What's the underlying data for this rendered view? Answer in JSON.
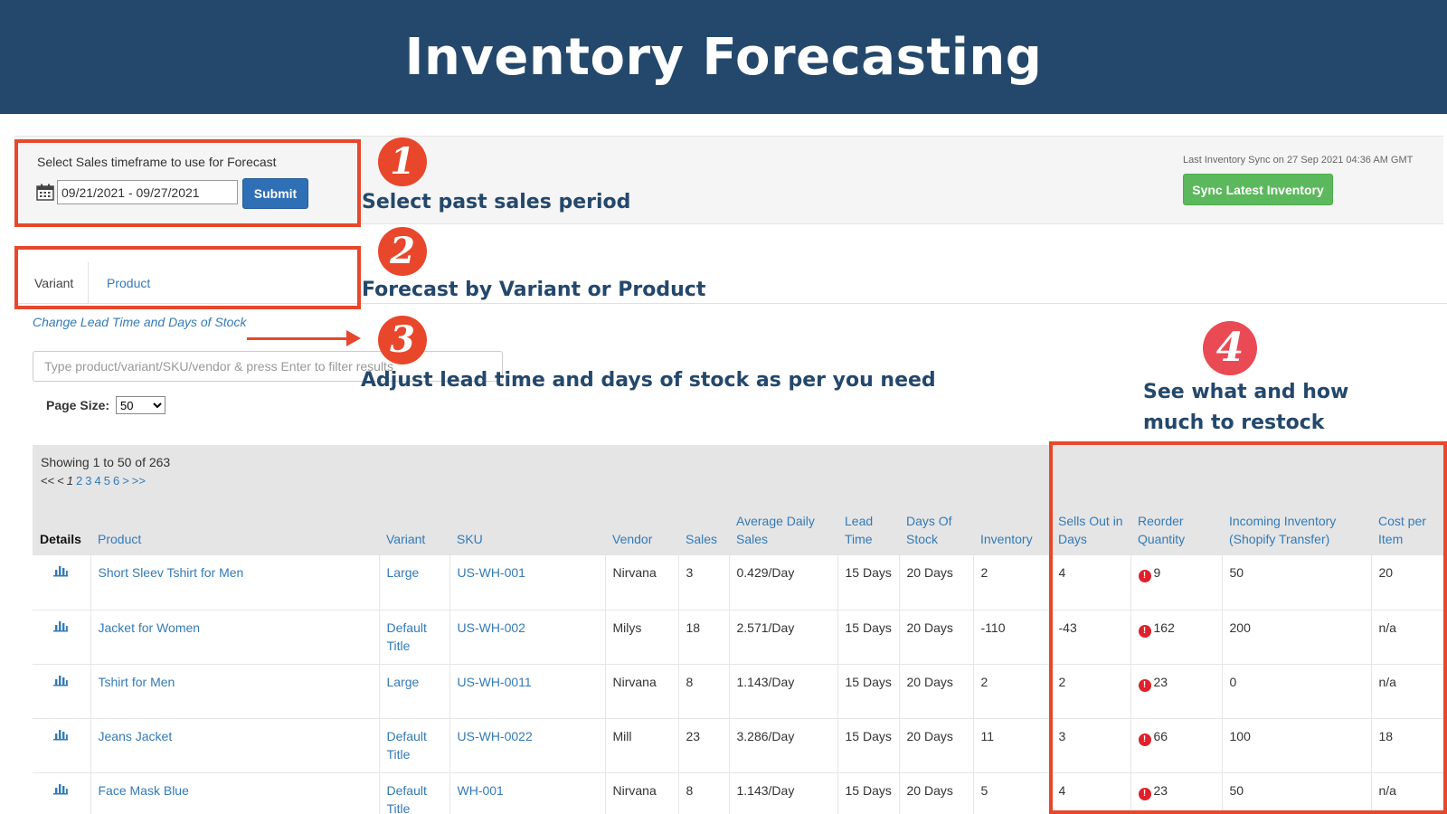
{
  "banner": {
    "title": "Inventory Forecasting"
  },
  "annotations": [
    {
      "number": "1",
      "text": "Select past sales period"
    },
    {
      "number": "2",
      "text": "Forecast  by Variant or Product"
    },
    {
      "number": "3",
      "text": "Adjust lead time and days of stock as per you need"
    },
    {
      "number": "4",
      "text": "See what and how much to restock"
    }
  ],
  "timeframe": {
    "label": "Select Sales timeframe to use for Forecast",
    "date_range": "09/21/2021 - 09/27/2021",
    "submit_label": "Submit"
  },
  "sync": {
    "last_sync_text": "Last Inventory Sync on 27 Sep 2021 04:36 AM GMT",
    "button_label": "Sync Latest Inventory"
  },
  "tabs": [
    {
      "label": "Variant",
      "active": true
    },
    {
      "label": "Product",
      "active": false
    }
  ],
  "lead_time_link": "Change Lead Time and Days of Stock",
  "filter": {
    "placeholder": "Type product/variant/SKU/vendor & press Enter to filter results"
  },
  "page_size": {
    "label": "Page Size:",
    "selected": "50"
  },
  "grid": {
    "showing": "Showing 1 to 50 of 263",
    "pager": {
      "first": "<<",
      "prev": "<",
      "current": "1",
      "pages": [
        "2",
        "3",
        "4",
        "5",
        "6"
      ],
      "next": ">",
      "last": ">>"
    },
    "columns": [
      "Details",
      "Product",
      "Variant",
      "SKU",
      "Vendor",
      "Sales",
      "Average Daily Sales",
      "Lead Time",
      "Days Of Stock",
      "Inventory",
      "Sells Out in Days",
      "Reorder Quantity",
      "Incoming Inventory (Shopify Transfer)",
      "Cost per Item"
    ],
    "rows": [
      {
        "product": "Short Sleev Tshirt for Men",
        "variant": "Large",
        "sku": "US-WH-001",
        "vendor": "Nirvana",
        "sales": "3",
        "avg_daily": "0.429/Day",
        "lead_time": "15 Days",
        "days_stock": "20 Days",
        "inventory": "2",
        "sells_out": "4",
        "reorder": "9",
        "incoming": "50",
        "cost": "20"
      },
      {
        "product": "Jacket for Women",
        "variant": "Default Title",
        "sku": "US-WH-002",
        "vendor": "Milys",
        "sales": "18",
        "avg_daily": "2.571/Day",
        "lead_time": "15 Days",
        "days_stock": "20 Days",
        "inventory": "-110",
        "sells_out": "-43",
        "reorder": "162",
        "incoming": "200",
        "cost": "n/a"
      },
      {
        "product": "Tshirt for Men",
        "variant": "Large",
        "sku": "US-WH-0011",
        "vendor": "Nirvana",
        "sales": "8",
        "avg_daily": "1.143/Day",
        "lead_time": "15 Days",
        "days_stock": "20 Days",
        "inventory": "2",
        "sells_out": "2",
        "reorder": "23",
        "incoming": "0",
        "cost": "n/a"
      },
      {
        "product": "Jeans Jacket",
        "variant": "Default Title",
        "sku": "US-WH-0022",
        "vendor": "Mill",
        "sales": "23",
        "avg_daily": "3.286/Day",
        "lead_time": "15 Days",
        "days_stock": "20 Days",
        "inventory": "11",
        "sells_out": "3",
        "reorder": "66",
        "incoming": "100",
        "cost": "18"
      },
      {
        "product": "Face Mask Blue",
        "variant": "Default Title",
        "sku": "WH-001",
        "vendor": "Nirvana",
        "sales": "8",
        "avg_daily": "1.143/Day",
        "lead_time": "15 Days",
        "days_stock": "20 Days",
        "inventory": "5",
        "sells_out": "4",
        "reorder": "23",
        "incoming": "50",
        "cost": "n/a"
      }
    ]
  },
  "colors": {
    "banner": "#24486c",
    "highlight": "#e8472b",
    "link": "#337ab7",
    "sync_button": "#5cb85c",
    "submit_button": "#2f6fb5"
  }
}
